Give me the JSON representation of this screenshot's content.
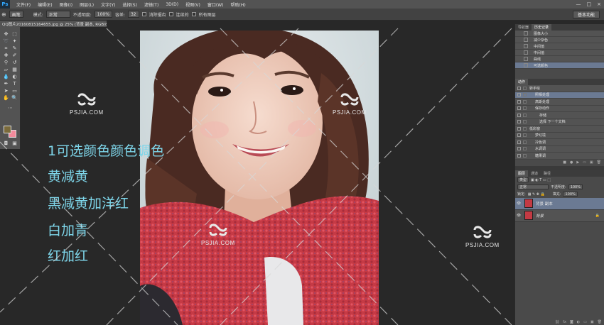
{
  "menu": {
    "logo": "Ps",
    "items": [
      "文件(F)",
      "编辑(E)",
      "图像(I)",
      "图层(L)",
      "文字(Y)",
      "选择(S)",
      "滤镜(T)",
      "3D(D)",
      "视图(V)",
      "窗口(W)",
      "帮助(H)"
    ],
    "window_controls": [
      "—",
      "□",
      "×"
    ]
  },
  "options": {
    "mode_preset": "画笔",
    "mode_label": "模式:",
    "mode_value": "正常",
    "opacity_label": "不透明度:",
    "opacity_value": "100%",
    "tolerance_label": "容差:",
    "tolerance_value": "32",
    "antialias_label": "消除锯齿",
    "contiguous_label": "连续的",
    "all_layers_label": "所有图层",
    "workspace": "基本功能"
  },
  "document": {
    "tab_title": "QQ图片20160815164655.jpg @ 25% (背景 副本, RGB/8) *"
  },
  "notes": [
    "1可选颜色颜色调色",
    "黄减黄",
    "黑减黄加洋红",
    "白加青",
    "红加红"
  ],
  "watermark": "PSJIA.COM",
  "history": {
    "tabs": [
      "导航器",
      "历史记录"
    ],
    "items": [
      "图像大小",
      "减少杂色",
      "中间值",
      "中间值",
      "曲线",
      "可选颜色"
    ],
    "selected": 5
  },
  "actions": {
    "tabs": [
      "动作"
    ],
    "items": [
      "转手绘",
      "照相处理",
      "高斯处理",
      "保存动作",
      "存储",
      "选择 下一个文档",
      "低彩窗",
      "梦幻境",
      "冷色调",
      "水调调",
      "糖果调"
    ]
  },
  "layers": {
    "tabs": [
      "图层",
      "通道",
      "路径"
    ],
    "kind": "类型",
    "blend_mode": "正常",
    "opacity_label": "不透明度:",
    "opacity_value": "100%",
    "lock_label": "锁定:",
    "fill_label": "填充:",
    "fill_value": "100%",
    "items": [
      {
        "name": "背景 副本",
        "selected": true,
        "locked": false
      },
      {
        "name": "背景",
        "selected": false,
        "locked": true
      }
    ]
  },
  "colors": {
    "foreground": "#7a6a3b",
    "background": "#f28a9b",
    "note_text": "#7ed6ea"
  }
}
